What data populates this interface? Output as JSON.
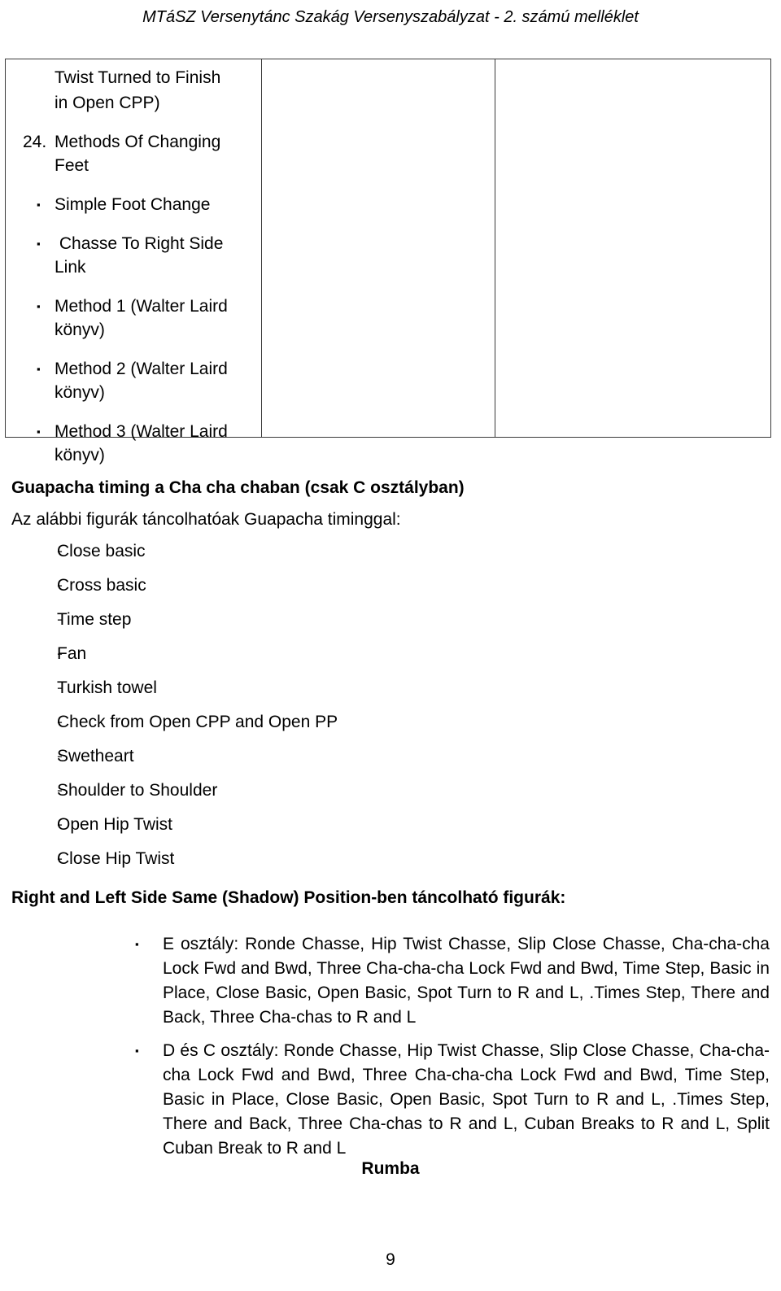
{
  "header": {
    "title": "MTáSZ Versenytánc Szakág Versenyszabályzat - 2. számú melléklet"
  },
  "table": {
    "columns": 3,
    "col1": {
      "continuation_lines": [
        "Twist Turned to Finish",
        "in Open CPP)"
      ],
      "numbered_item": {
        "number": "24.",
        "text": "Methods Of Changing Feet"
      },
      "bullet_marker": "▪",
      "bullets": [
        "Simple Foot Change",
        " Chasse To Right Side Link",
        "Method 1 (Walter Laird könyv)",
        "Method 2 (Walter Laird könyv)",
        "Method 3 (Walter Laird könyv)"
      ]
    },
    "col2": {
      "content": ""
    },
    "col3": {
      "content": ""
    }
  },
  "guapacha": {
    "heading": "Guapacha timing a Cha cha chaban (csak C osztályban)",
    "intro": "Az alábbi figurák táncolhatóak Guapacha timinggal:",
    "dash_marker": "-",
    "items": [
      "Close basic",
      "Cross basic",
      "Time step",
      "Fan",
      "Turkish towel",
      "Check from Open CPP and Open PP",
      "Swetheart",
      "Shoulder to Shoulder",
      "Open Hip Twist",
      "Close Hip Twist"
    ]
  },
  "shadow": {
    "heading": "Right and Left Side Same (Shadow) Position-ben táncolható figurák:",
    "bullet_marker": "▪",
    "paragraphs": [
      "E osztály: Ronde Chasse, Hip Twist Chasse, Slip Close Chasse, Cha-cha-cha Lock Fwd and Bwd, Three Cha-cha-cha Lock Fwd and Bwd, Time Step, Basic in Place, Close Basic, Open Basic, Spot Turn to R and L, .Times Step, There and Back, Three Cha-chas to R and L",
      "D és C osztály: Ronde Chasse, Hip Twist Chasse, Slip Close Chasse, Cha-cha-cha Lock Fwd and Bwd, Three Cha-cha-cha Lock Fwd and Bwd, Time Step, Basic in Place, Close Basic, Open Basic, Spot Turn to R and L, .Times Step, There and Back, Three Cha-chas to R and L, Cuban Breaks to R and L, Split Cuban Break to R and L"
    ]
  },
  "rumba": {
    "heading": "Rumba"
  },
  "footer": {
    "page_number": "9"
  }
}
